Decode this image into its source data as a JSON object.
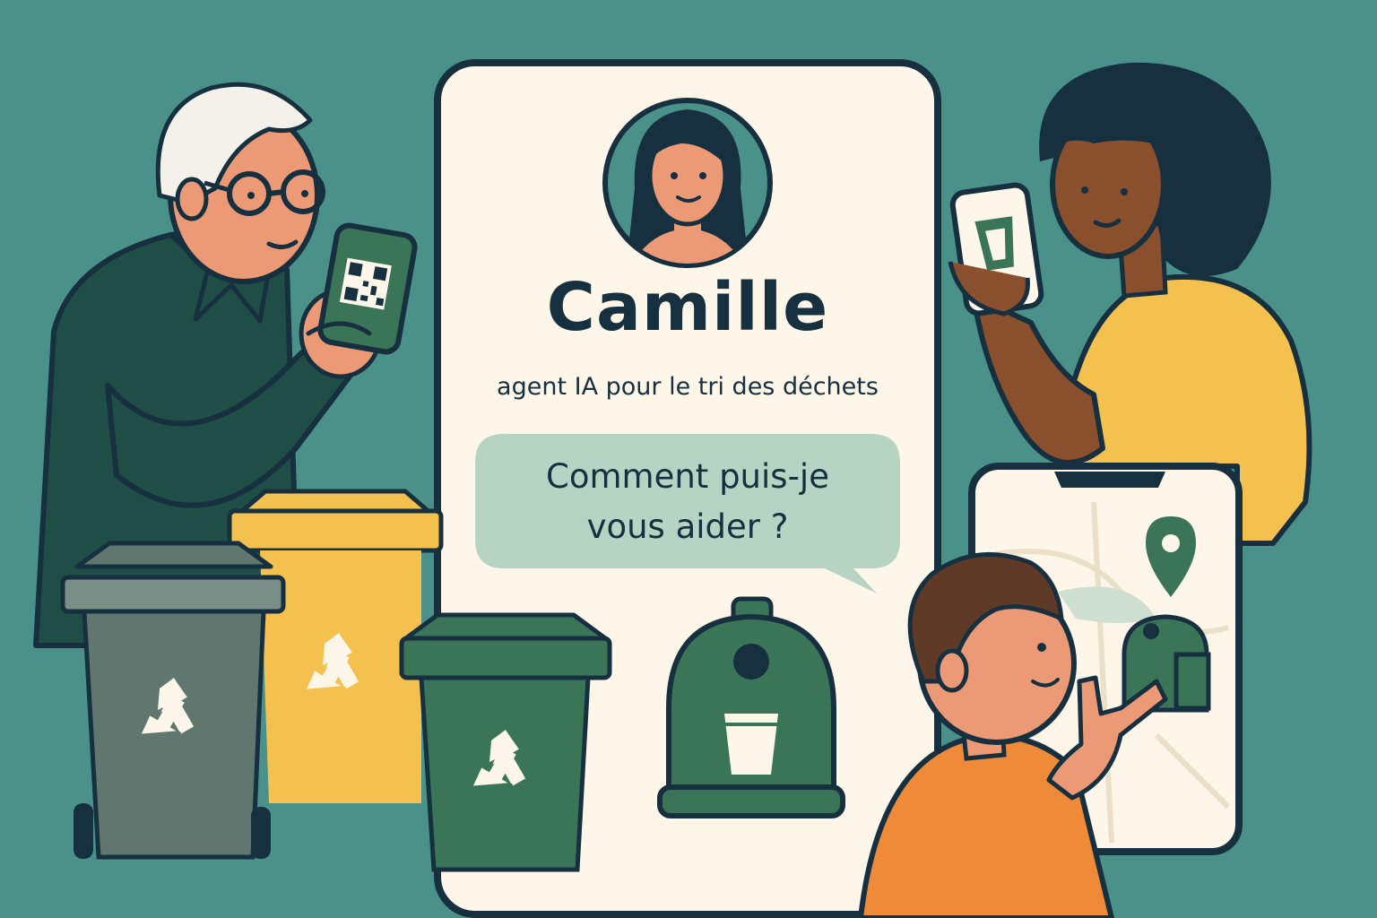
{
  "agent": {
    "name": "Camille",
    "subtitle": "agent IA pour le tri des déchets",
    "greeting_line1": "Comment puis-je",
    "greeting_line2": "vous aider ?"
  },
  "icons": [
    "agent-avatar-icon",
    "qr-code-icon",
    "cup-icon",
    "map-pin-icon",
    "recycling-icon",
    "glass-container-icon"
  ],
  "colors": {
    "background": "#4a9189",
    "card": "#fdf6e9",
    "outline": "#173040",
    "bubble": "#b7d3c3",
    "bin_grey": "#5f776f",
    "bin_yellow": "#f4c14f",
    "bin_green": "#3b7558"
  }
}
